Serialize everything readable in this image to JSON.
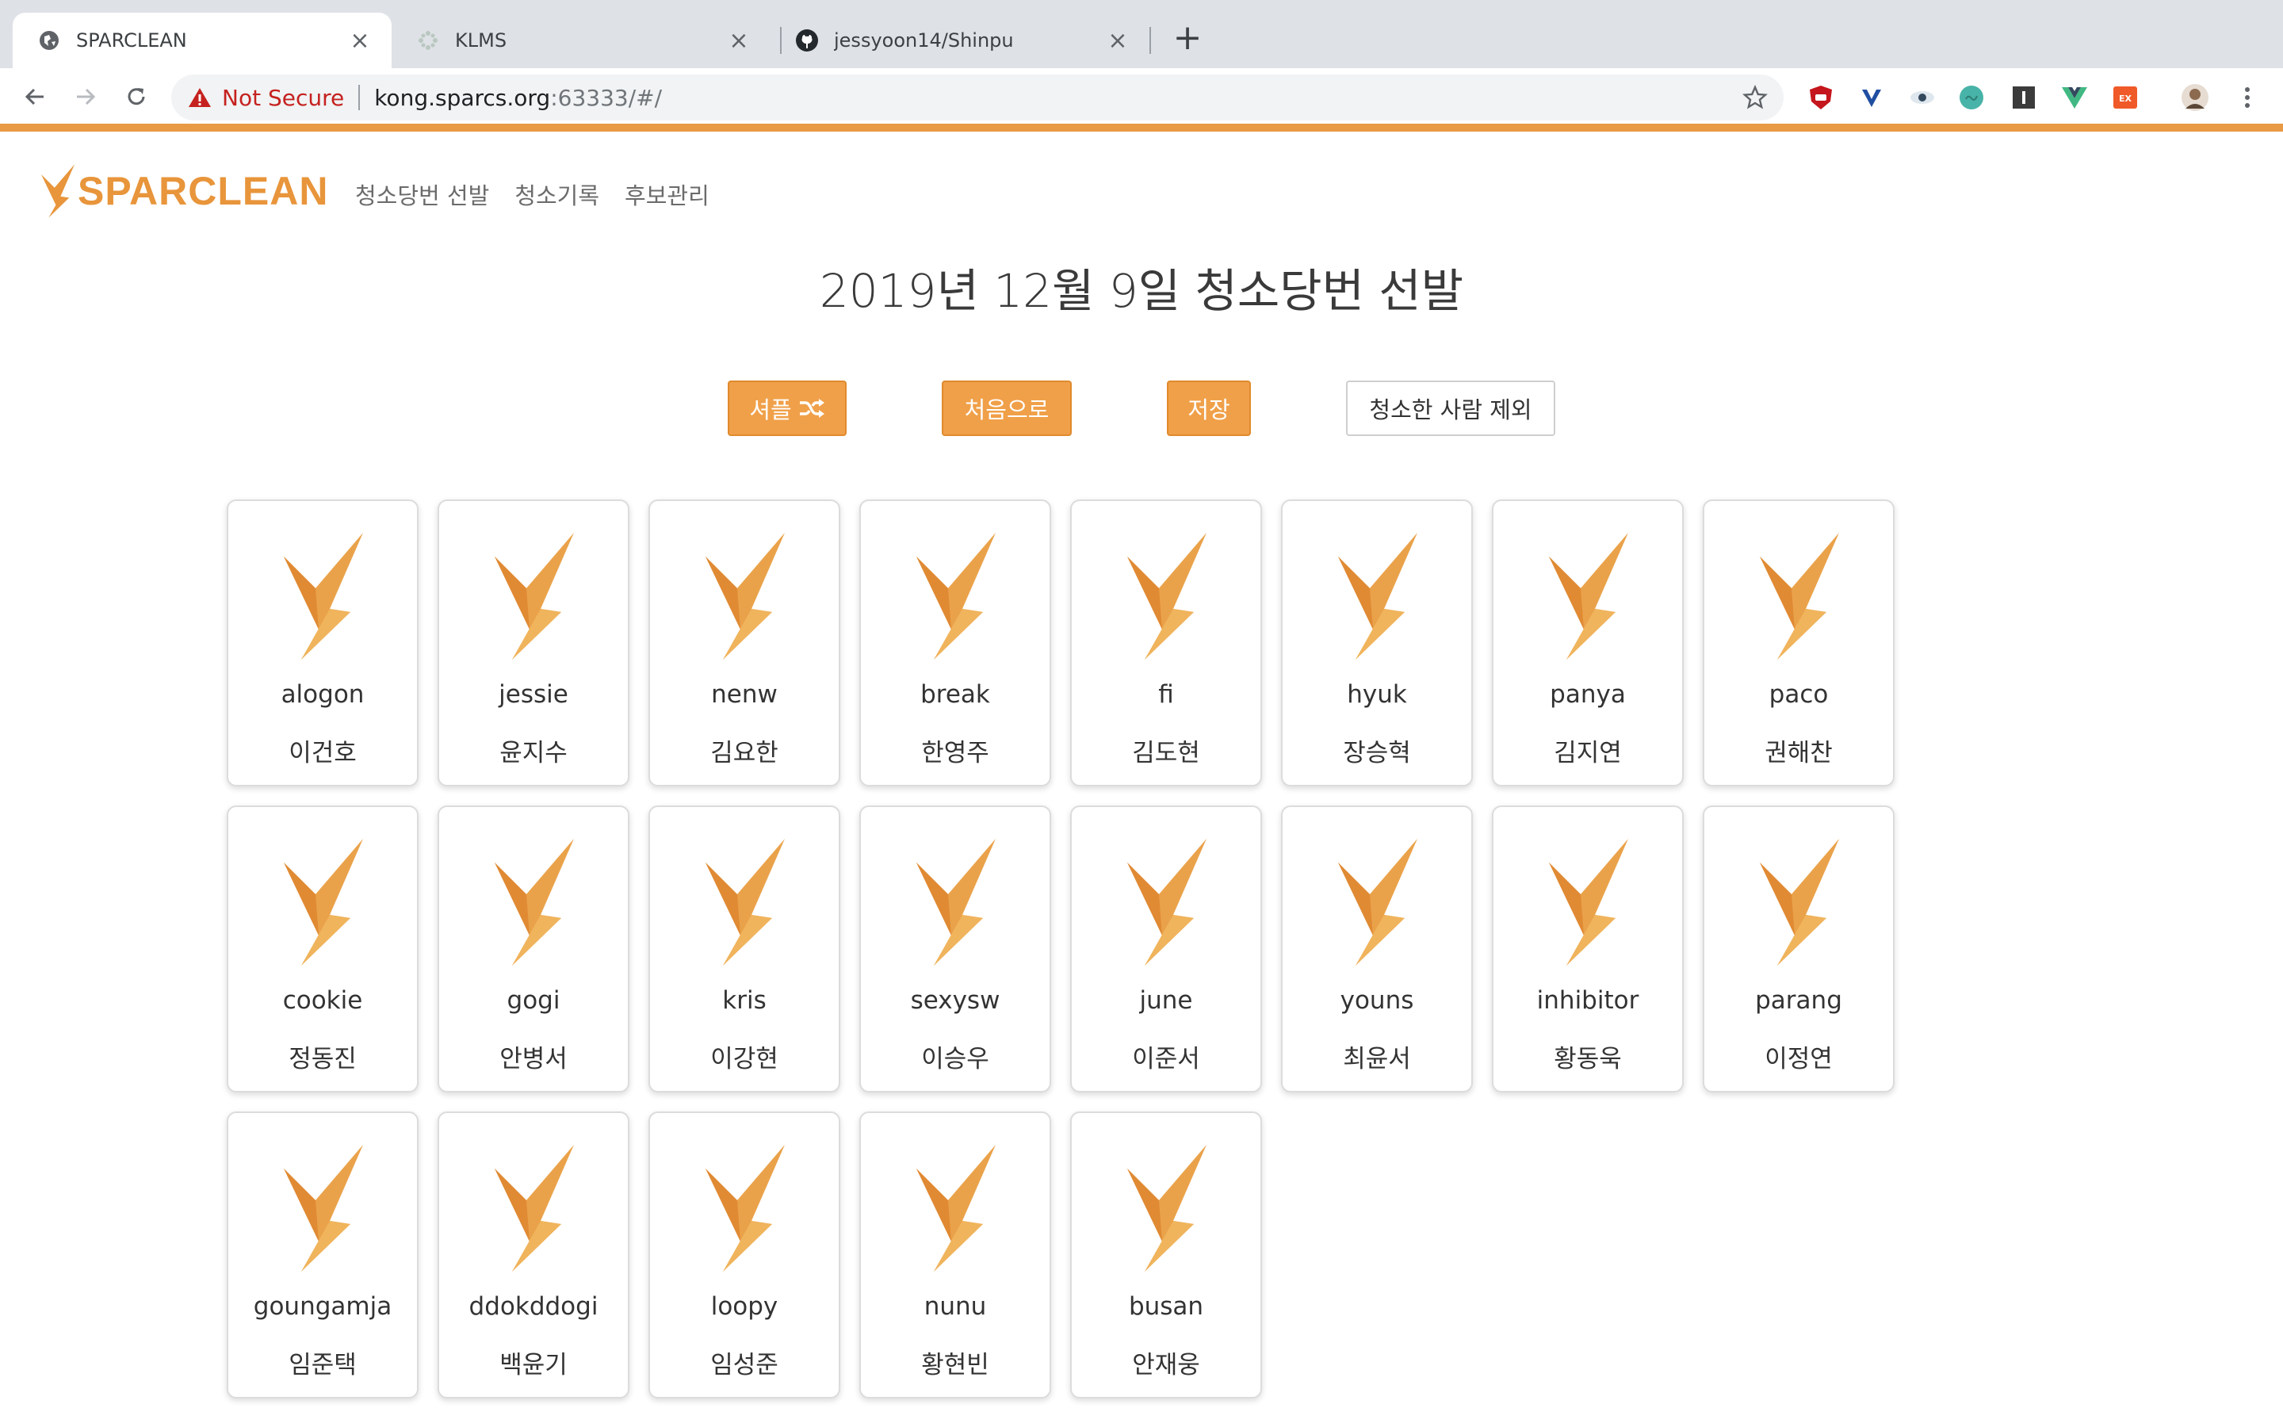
{
  "browser": {
    "tabs": [
      {
        "title": "SPARCLEAN",
        "icon": "globe-icon",
        "active": true
      },
      {
        "title": "KLMS",
        "icon": "klms-icon",
        "active": false
      },
      {
        "title": "jessyoon14/Shinpu",
        "icon": "github-icon",
        "active": false
      }
    ],
    "close_glyph": "×",
    "new_tab_glyph": "+",
    "address": {
      "security_label": "Not Secure",
      "host": "kong.sparcs.org",
      "path": ":63333/#/"
    },
    "extensions": [
      "ublock-icon",
      "vivaldi-icon",
      "eye-icon",
      "teal-circle-icon",
      "instapaper-icon",
      "vue-devtools-icon",
      "ex-icon",
      "profile-avatar",
      "menu-icon"
    ]
  },
  "app": {
    "brand": "SPARCLEAN",
    "accent_color": "#e8953b",
    "nav": [
      "청소당번 선발",
      "청소기록",
      "후보관리"
    ],
    "title": "2019년 12월 9일 청소당번 선발",
    "buttons": {
      "shuffle": "셔플",
      "reset": "처음으로",
      "save": "저장",
      "exclude": "청소한 사람 제외"
    },
    "members": [
      {
        "nick": "alogon",
        "name": "이건호"
      },
      {
        "nick": "jessie",
        "name": "윤지수"
      },
      {
        "nick": "nenw",
        "name": "김요한"
      },
      {
        "nick": "break",
        "name": "한영주"
      },
      {
        "nick": "fi",
        "name": "김도현"
      },
      {
        "nick": "hyuk",
        "name": "장승혁"
      },
      {
        "nick": "panya",
        "name": "김지연"
      },
      {
        "nick": "paco",
        "name": "권해찬"
      },
      {
        "nick": "cookie",
        "name": "정동진"
      },
      {
        "nick": "gogi",
        "name": "안병서"
      },
      {
        "nick": "kris",
        "name": "이강현"
      },
      {
        "nick": "sexysw",
        "name": "이승우"
      },
      {
        "nick": "june",
        "name": "이준서"
      },
      {
        "nick": "youns",
        "name": "최윤서"
      },
      {
        "nick": "inhibitor",
        "name": "황동욱"
      },
      {
        "nick": "parang",
        "name": "이정연"
      },
      {
        "nick": "goungamja",
        "name": "임준택"
      },
      {
        "nick": "ddokddogi",
        "name": "백윤기"
      },
      {
        "nick": "loopy",
        "name": "임성준"
      },
      {
        "nick": "nunu",
        "name": "황현빈"
      },
      {
        "nick": "busan",
        "name": "안재웅"
      }
    ]
  }
}
